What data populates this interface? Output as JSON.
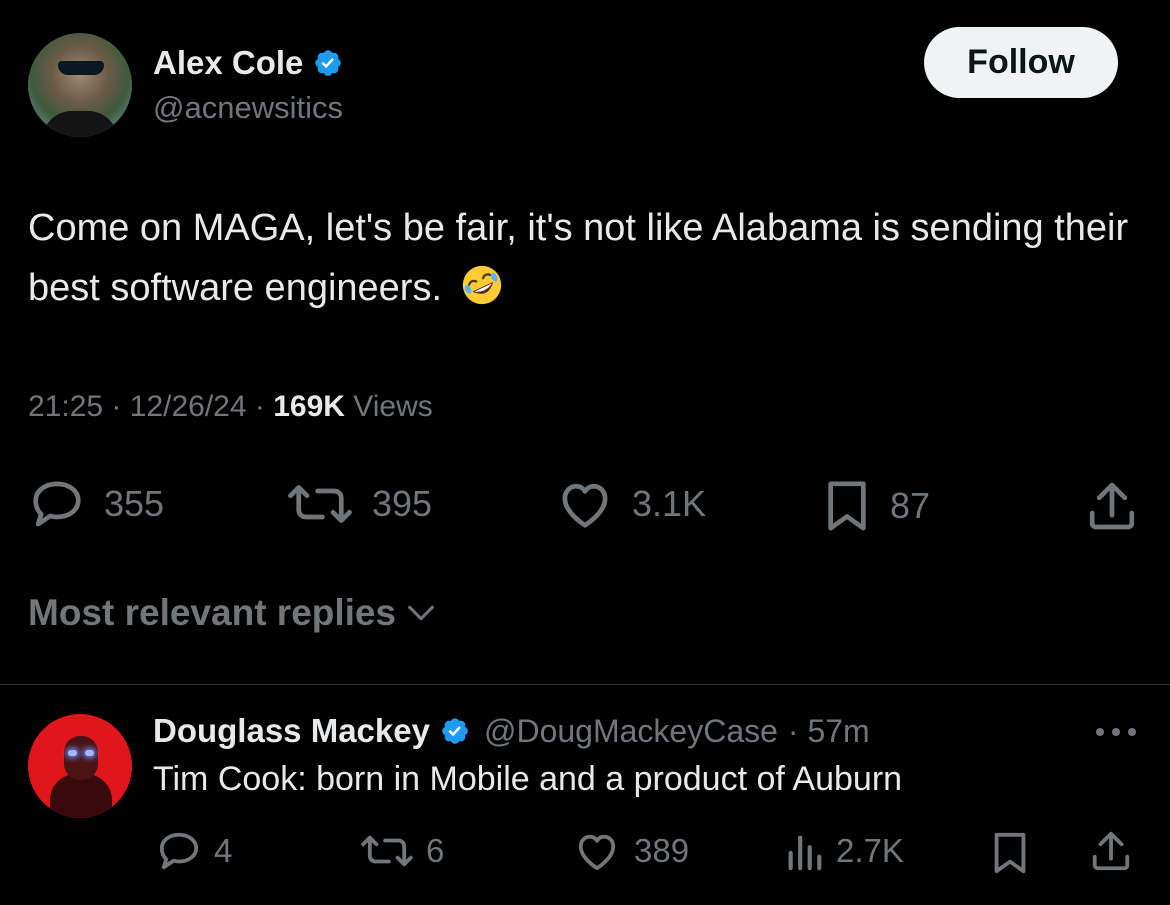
{
  "tweet": {
    "author_name": "Alex Cole",
    "author_handle": "@acnewsitics",
    "follow_label": "Follow",
    "text": "Come on MAGA, let's be fair, it's not like Alabama is sending their best software engineers.",
    "emoji": "rolling-on-floor-laughing",
    "time": "21:25",
    "date": "12/26/24",
    "views_count": "169K",
    "views_label": "Views",
    "separator": "·",
    "replies": "355",
    "reposts": "395",
    "likes": "3.1K",
    "bookmarks": "87"
  },
  "replies_section": {
    "sort_label": "Most relevant replies"
  },
  "reply": {
    "author_name": "Douglass Mackey",
    "author_handle": "@DougMackeyCase",
    "time_ago": "· 57m",
    "text": "Tim Cook: born in Mobile and a product of Auburn",
    "replies": "4",
    "reposts": "6",
    "likes": "389",
    "views": "2.7K"
  },
  "colors": {
    "background": "#000000",
    "text_primary": "#e7e9ea",
    "text_secondary": "#71767b",
    "verified_blue": "#1d9bf0",
    "follow_bg": "#eff3f4",
    "divider": "#2f3336"
  },
  "icons": {
    "reply": "reply-bubble-icon",
    "repost": "repost-icon",
    "like": "heart-icon",
    "bookmark": "bookmark-icon",
    "share": "share-icon",
    "views": "bar-chart-icon",
    "more": "more-dots-icon",
    "verified": "verified-badge-icon",
    "chevron": "chevron-down-icon"
  }
}
